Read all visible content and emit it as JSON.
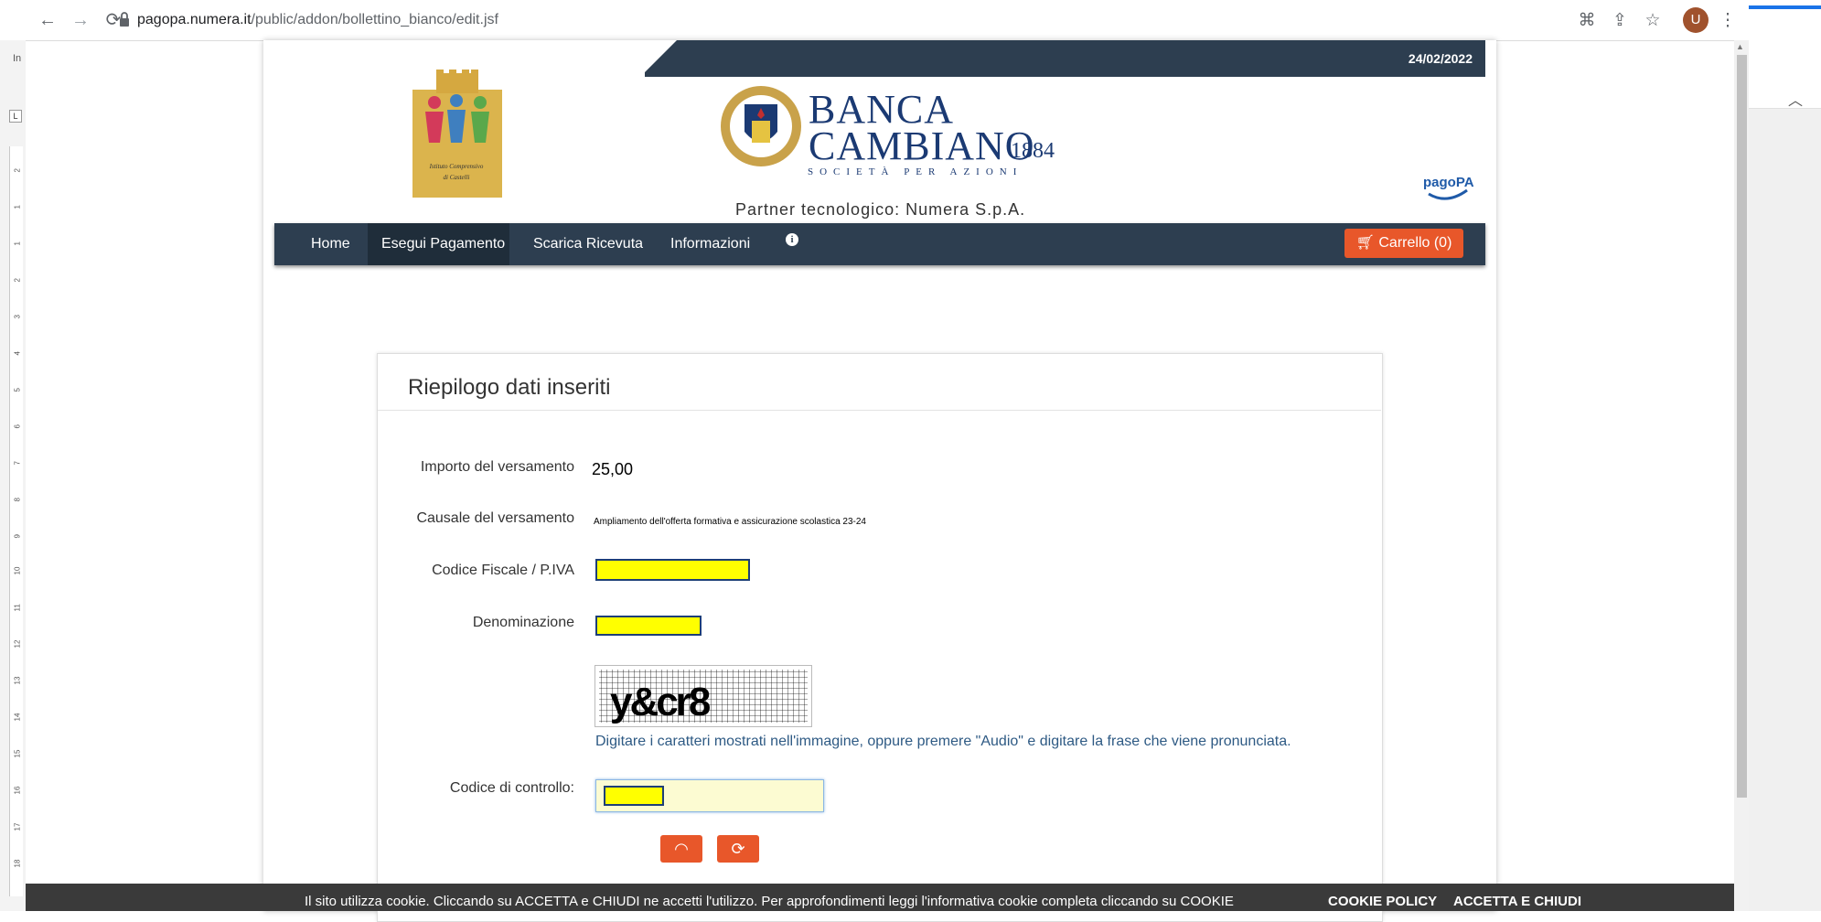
{
  "browser": {
    "url_host": "pagopa.numera.it",
    "url_path": "/public/addon/bollettino_bianco/edit.jsf",
    "avatar_letter": "U",
    "icons": [
      "back-icon",
      "forward-icon",
      "reload-icon",
      "lock-icon",
      "translate-icon",
      "share-icon",
      "star-icon",
      "kebab-menu-icon"
    ]
  },
  "side": {
    "left_letters": "In",
    "ruler_marks": [
      "2",
      "1",
      "1",
      "2",
      "3",
      "4",
      "5",
      "6",
      "7",
      "8",
      "9",
      "10",
      "11",
      "12",
      "13",
      "14",
      "15",
      "16",
      "17",
      "18"
    ]
  },
  "header": {
    "date": "24/02/2022",
    "school_logo_text": "Istituto Comprensivo di Castelli",
    "bank_line1": "BANCA",
    "bank_line2": "CAMBIANO",
    "bank_year": "1884",
    "bank_subtitle": "SOCIETÀ PER AZIONI",
    "partner": "Partner tecnologico: Numera S.p.A.",
    "pagopa_logo": "pagoPA"
  },
  "nav": {
    "items": [
      "Home",
      "Esegui Pagamento",
      "Scarica Ricevuta",
      "Informazioni"
    ],
    "active": "Esegui Pagamento",
    "cart": "Carrello (0)"
  },
  "panel": {
    "title": "Riepilogo dati inseriti",
    "fields": [
      {
        "label": "Importo del versamento",
        "value": "25,00"
      },
      {
        "label": "Causale del versamento",
        "value": "Ampliamento dell'offerta formativa e assicurazione scolastica 23-24"
      },
      {
        "label": "Codice Fiscale / P.IVA",
        "value": ""
      },
      {
        "label": "Denominazione",
        "value": ""
      }
    ],
    "captcha_text": "y&cr8",
    "hint": "Digitare i caratteri mostrati nell'immagine, oppure premere \"Audio\" e digitare la frase che viene pronunciata.",
    "control_label": "Codice di controllo:",
    "control_value": ""
  },
  "cookie": {
    "text": "Il sito utilizza cookie. Cliccando su ACCETTA e CHIUDI ne accetti l'utilizzo. Per approfondimenti leggi l'informativa cookie completa cliccando su COOKIE",
    "policy": "COOKIE POLICY",
    "accept": "ACCETTA E CHIUDI"
  }
}
